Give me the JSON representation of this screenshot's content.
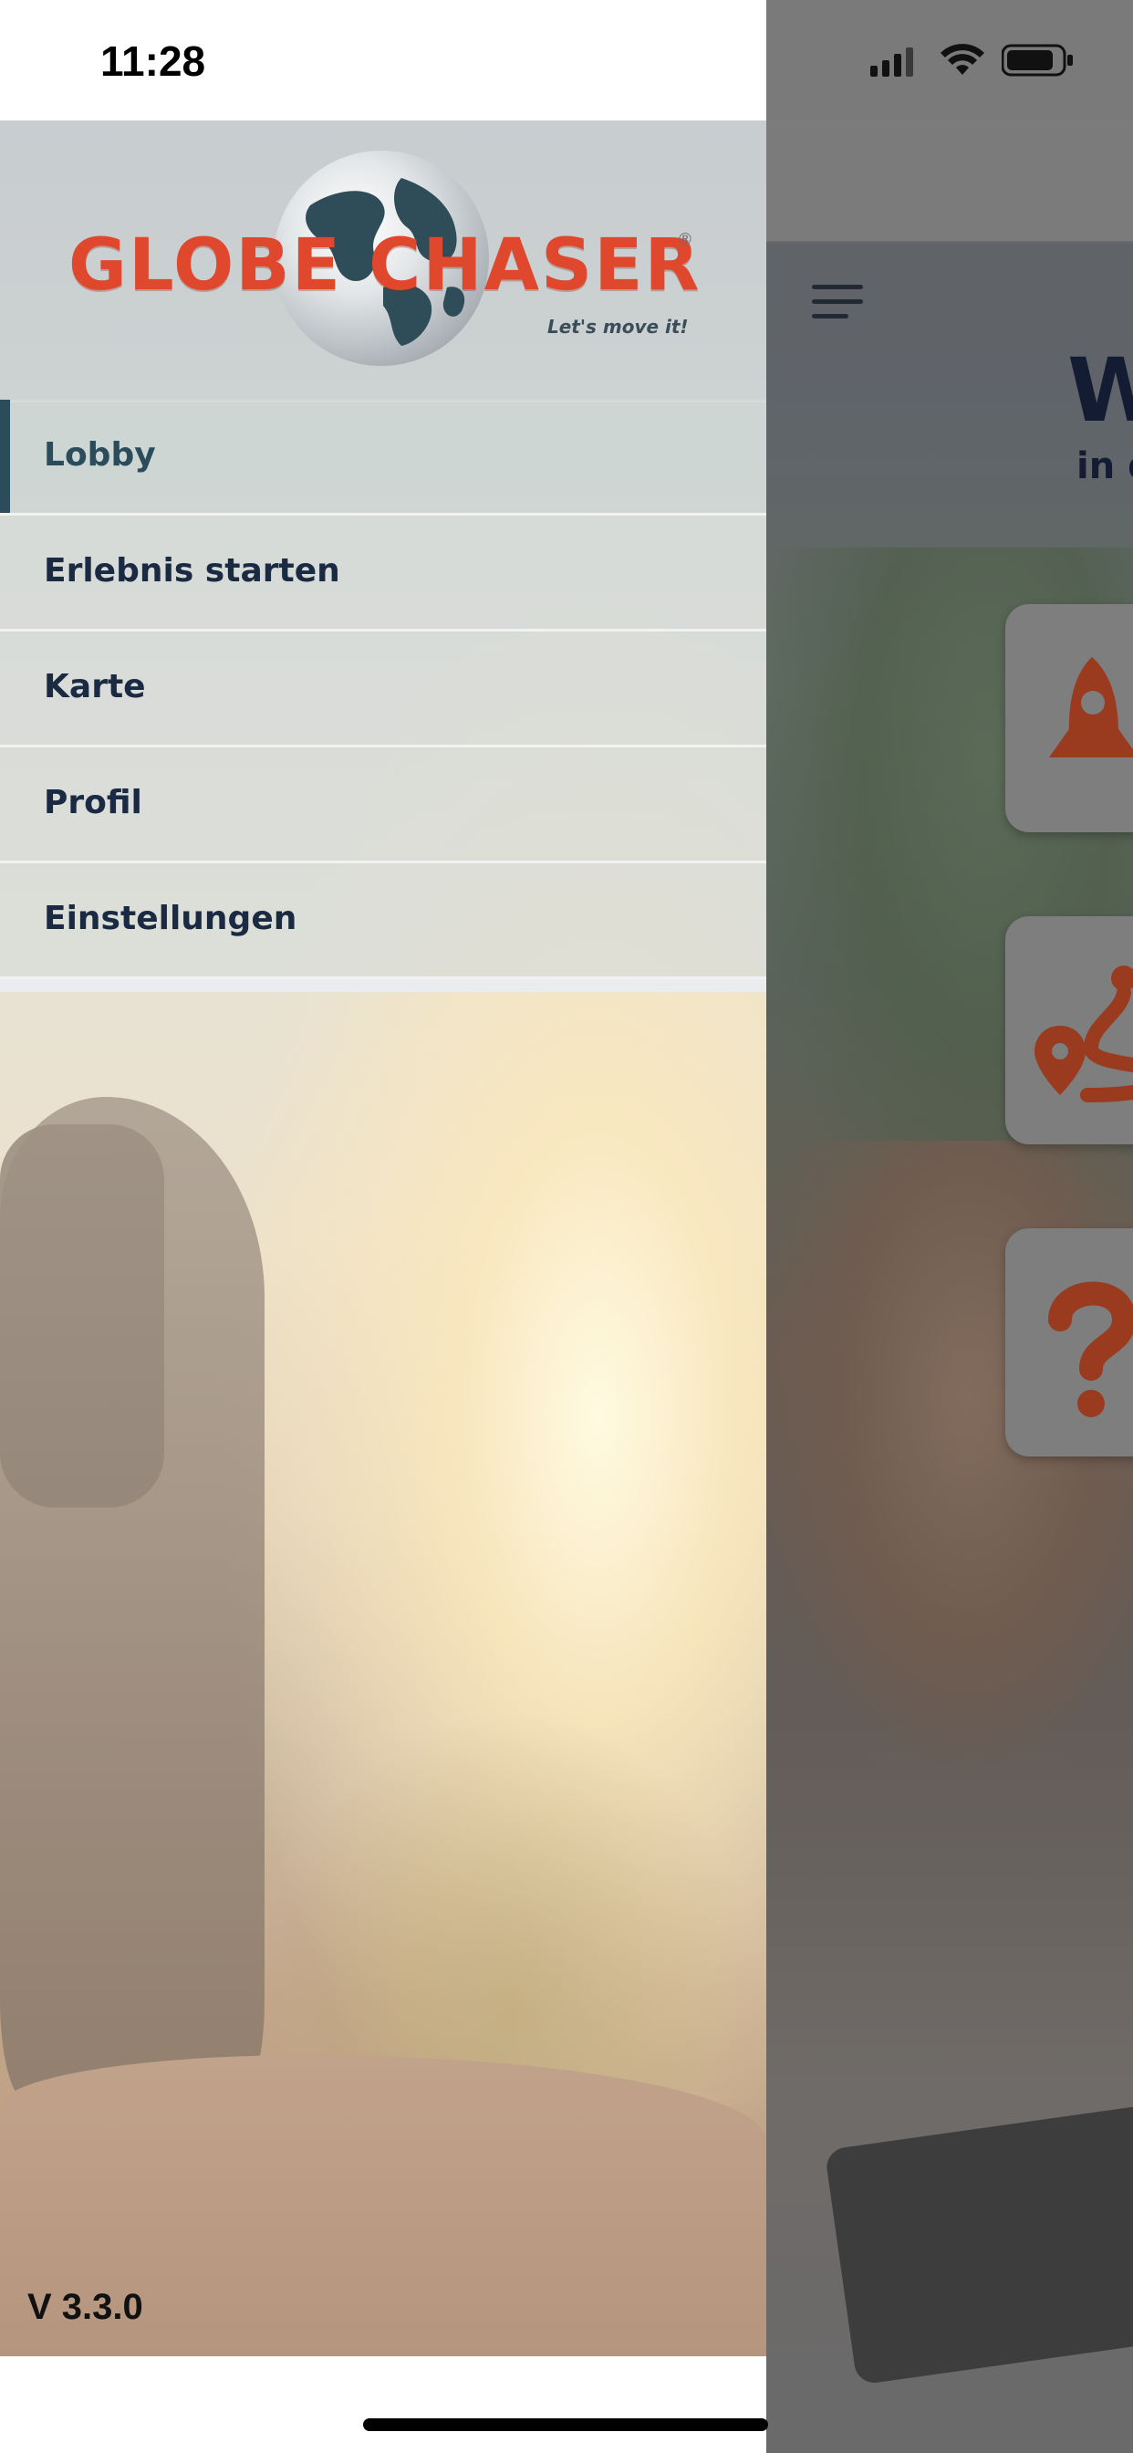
{
  "status_bar": {
    "time": "11:28"
  },
  "drawer": {
    "logo": {
      "brand_text": "GLOBE CHASER",
      "tagline": "Let's move it!",
      "registered_mark": "®"
    },
    "menu": [
      {
        "label": "Lobby",
        "active": true
      },
      {
        "label": "Erlebnis starten",
        "active": false
      },
      {
        "label": "Karte",
        "active": false
      },
      {
        "label": "Profil",
        "active": false
      },
      {
        "label": "Einstellungen",
        "active": false
      }
    ],
    "version": "V 3.3.0"
  },
  "main": {
    "title_partial": "W",
    "subtitle_partial": "in d",
    "tiles": [
      {
        "icon": "rocket-icon"
      },
      {
        "icon": "route-pin-icon"
      },
      {
        "icon": "question-mark-icon"
      }
    ]
  },
  "colors": {
    "brand_orange": "#e0482d",
    "nav_dark": "#1b2a43",
    "active_indicator": "#2b4d5b",
    "tile_icon": "#9a3a1e"
  }
}
